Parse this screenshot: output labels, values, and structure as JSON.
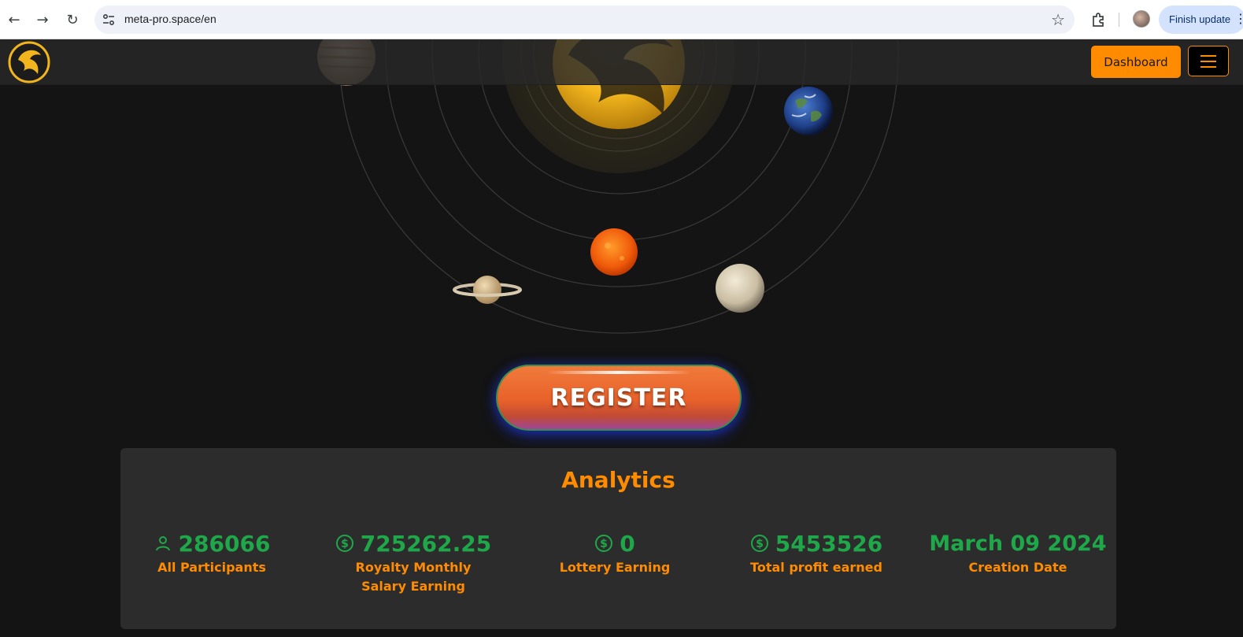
{
  "browser": {
    "url": "meta-pro.space/en",
    "finish_update_label": "Finish update"
  },
  "site": {
    "dashboard_label": "Dashboard",
    "register_label": "REGISTER"
  },
  "analytics": {
    "title": "Analytics",
    "stats": [
      {
        "icon": "user-icon",
        "value": "286066",
        "label": "All Participants"
      },
      {
        "icon": "dollar-icon",
        "value": "725262.25",
        "label": "Royalty Monthly Salary Earning"
      },
      {
        "icon": "dollar-icon",
        "value": "0",
        "label": "Lottery Earning"
      },
      {
        "icon": "dollar-icon",
        "value": "5453526",
        "label": "Total profit earned"
      },
      {
        "icon": "",
        "value": "March 09 2024",
        "label": "Creation Date"
      }
    ]
  },
  "colors": {
    "accent": "#ff8c00",
    "stat_value": "#1fa84a",
    "panel_bg": "#2c2c2c",
    "page_bg": "#141414"
  }
}
